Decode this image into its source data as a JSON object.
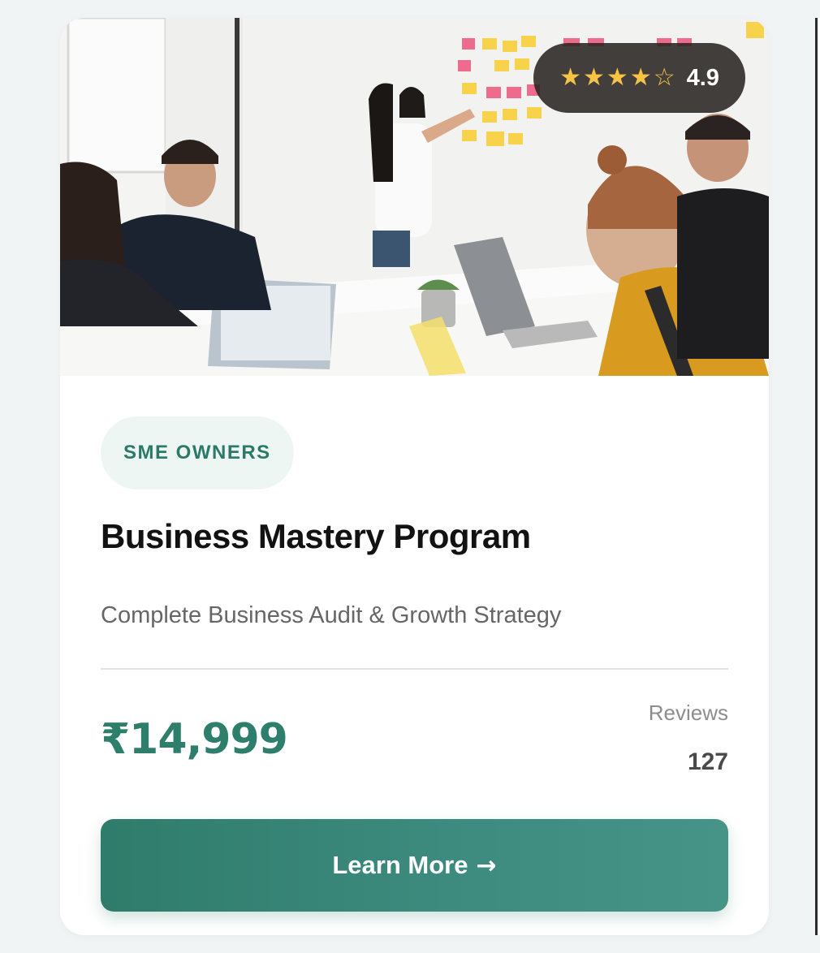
{
  "course": {
    "rating_stars": [
      "★",
      "★",
      "★",
      "★",
      "☆"
    ],
    "rating_value": "4.9",
    "tag": "SME OWNERS",
    "title": "Business Mastery Program",
    "subtitle": "Complete Business Audit & Growth Strategy",
    "price": "₹14,999",
    "reviews_label": "Reviews",
    "reviews_count": "127",
    "cta_label": "Learn More",
    "cta_arrow": "→"
  },
  "colors": {
    "accent": "#2e7e6c",
    "star": "#f6c344",
    "tag_bg": "#eef6f4",
    "button_start": "#2f7c6b",
    "button_end": "#469488"
  },
  "icons": {
    "star_icon": "star-icon",
    "arrow_icon": "arrow-right-icon"
  }
}
